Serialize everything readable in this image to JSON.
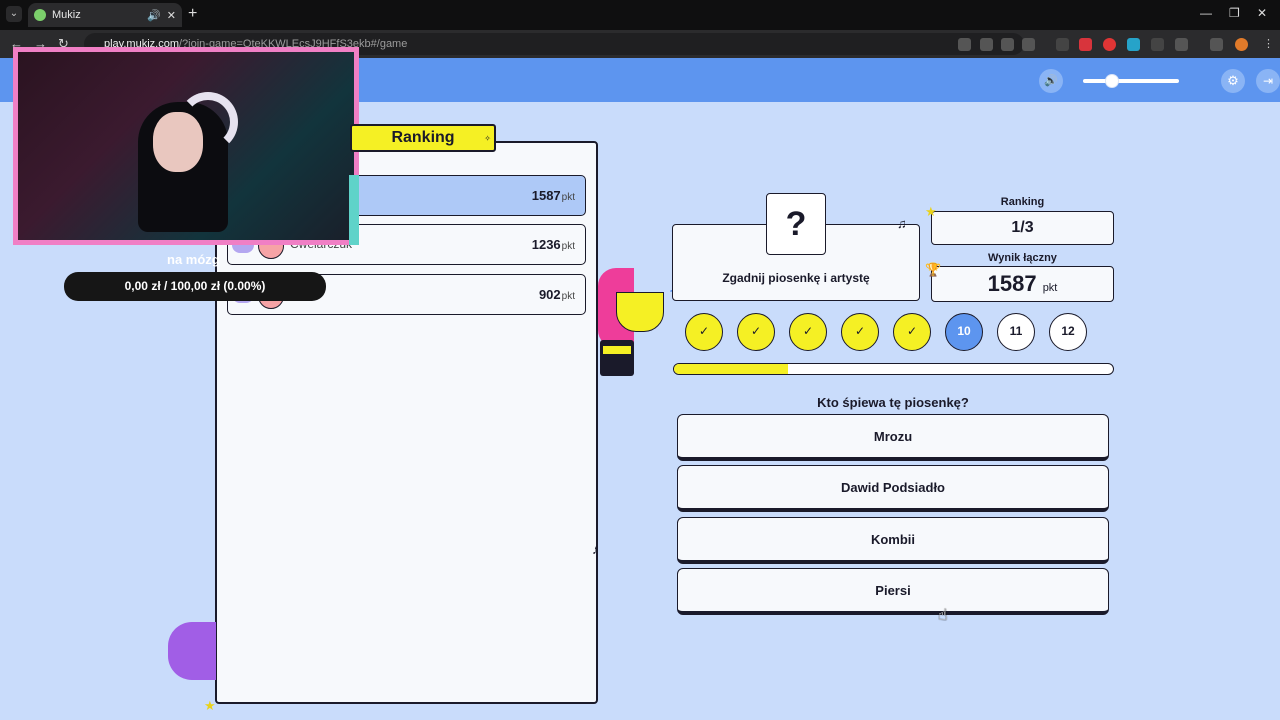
{
  "browser": {
    "tab_title": "Mukiz",
    "url_host": "play.mukiz.com",
    "url_path": "/?join-game=OteKKWLEcsJ9HFfS3ekb#/game"
  },
  "game": {
    "ranking_tab_label": "Ranking",
    "leaderboard": [
      {
        "name": "",
        "score": "1587",
        "unit": "pkt",
        "active": true
      },
      {
        "name": "Cwelarczuk",
        "score": "1236",
        "unit": "pkt",
        "active": false
      },
      {
        "name": "",
        "score": "902",
        "unit": "pkt",
        "active": false
      }
    ],
    "question_mark": "?",
    "question_type": "Zgadnij piosenkę i artystę",
    "stats": {
      "ranking_label": "Ranking",
      "ranking_value": "1/3",
      "total_label": "Wynik łączny",
      "total_value": "1587",
      "total_unit": "pkt"
    },
    "rounds": [
      {
        "label": "✓",
        "state": "done"
      },
      {
        "label": "✓",
        "state": "done"
      },
      {
        "label": "✓",
        "state": "done"
      },
      {
        "label": "✓",
        "state": "done"
      },
      {
        "label": "✓",
        "state": "done"
      },
      {
        "label": "10",
        "state": "current"
      },
      {
        "label": "11",
        "state": "next"
      },
      {
        "label": "12",
        "state": "next"
      }
    ],
    "timer_progress": 0.26,
    "answer_prompt": "Kto śpiewa tę piosenkę?",
    "answers": [
      "Mrozu",
      "Dawid Podsiadło",
      "Kombii",
      "Piersi"
    ],
    "volume_level": 0.3
  },
  "stream_overlay": {
    "donation_label": "na mózg",
    "donation_text": "0,00 zł / 100,00 zł (0.00%)"
  },
  "colors": {
    "header_blue": "#5d95ef",
    "accent_yellow": "#f5f024",
    "background": "#c9dcfb"
  }
}
